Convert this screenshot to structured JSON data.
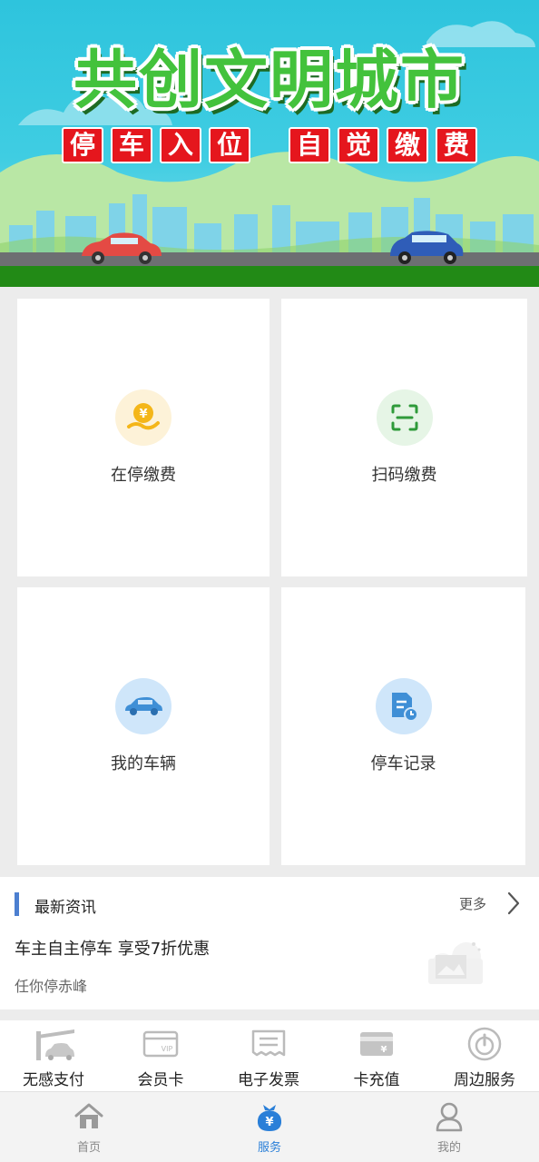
{
  "banner": {
    "title": "共创文明城市",
    "slogan_left": [
      "停",
      "车",
      "入",
      "位"
    ],
    "slogan_right": [
      "自",
      "觉",
      "缴",
      "费"
    ]
  },
  "services": [
    {
      "label": "在停缴费",
      "icon": "yuan-hand-icon",
      "color": "#f4b619",
      "bg": "#fdf2d8"
    },
    {
      "label": "扫码缴费",
      "icon": "scan-icon",
      "color": "#2f9a3a",
      "bg": "#e6f5e6"
    },
    {
      "label": "我的车辆",
      "icon": "car-icon",
      "color": "#3f8fd6",
      "bg": "#cfe6fa"
    },
    {
      "label": "停车记录",
      "icon": "record-icon",
      "color": "#3f8fd6",
      "bg": "#cfe6fa"
    }
  ],
  "news": {
    "section_title": "最新资讯",
    "more_label": "更多",
    "headline": "车主自主停车 享受7折优惠",
    "source": "任你停赤峰"
  },
  "quick_services": [
    {
      "label": "无感支付",
      "icon": "barrier-gate-icon"
    },
    {
      "label": "会员卡",
      "icon": "vip-card-icon"
    },
    {
      "label": "电子发票",
      "icon": "invoice-icon"
    },
    {
      "label": "卡充值",
      "icon": "card-recharge-icon"
    },
    {
      "label": "周边服务",
      "icon": "nearby-icon"
    }
  ],
  "tabs": [
    {
      "label": "首页",
      "icon": "home-icon",
      "active": false
    },
    {
      "label": "服务",
      "icon": "service-bag-icon",
      "active": true
    },
    {
      "label": "我的",
      "icon": "profile-icon",
      "active": false
    }
  ],
  "colors": {
    "accent": "#2a7fd8",
    "slogan_red": "#e5161d",
    "title_green": "#43c23c"
  }
}
